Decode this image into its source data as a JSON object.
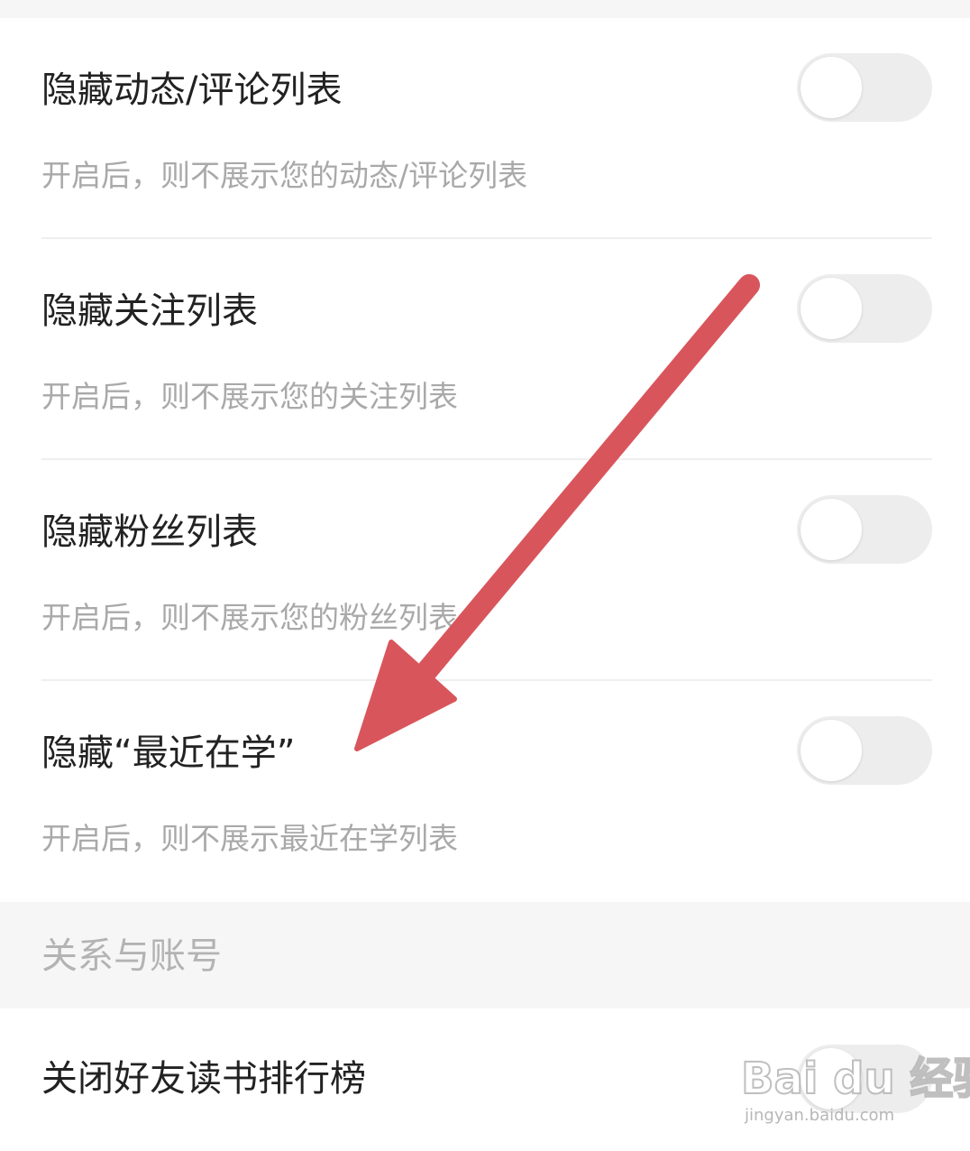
{
  "settings": [
    {
      "title": "隐藏动态/评论列表",
      "description": "开启后，则不展示您的动态/评论列表",
      "enabled": false
    },
    {
      "title": "隐藏关注列表",
      "description": "开启后，则不展示您的关注列表",
      "enabled": false
    },
    {
      "title": "隐藏粉丝列表",
      "description": "开启后，则不展示您的粉丝列表",
      "enabled": false
    },
    {
      "title": "隐藏“最近在学”",
      "description": "开启后，则不展示最近在学列表",
      "enabled": false
    }
  ],
  "section": {
    "title": "关系与账号",
    "items": [
      {
        "title": "关闭好友读书排行榜",
        "enabled": false
      }
    ]
  },
  "annotation": {
    "arrow_color": "#d9555c"
  },
  "watermark": {
    "logo_text": "Bai du 经验",
    "url": "jingyan.baidu.com"
  }
}
